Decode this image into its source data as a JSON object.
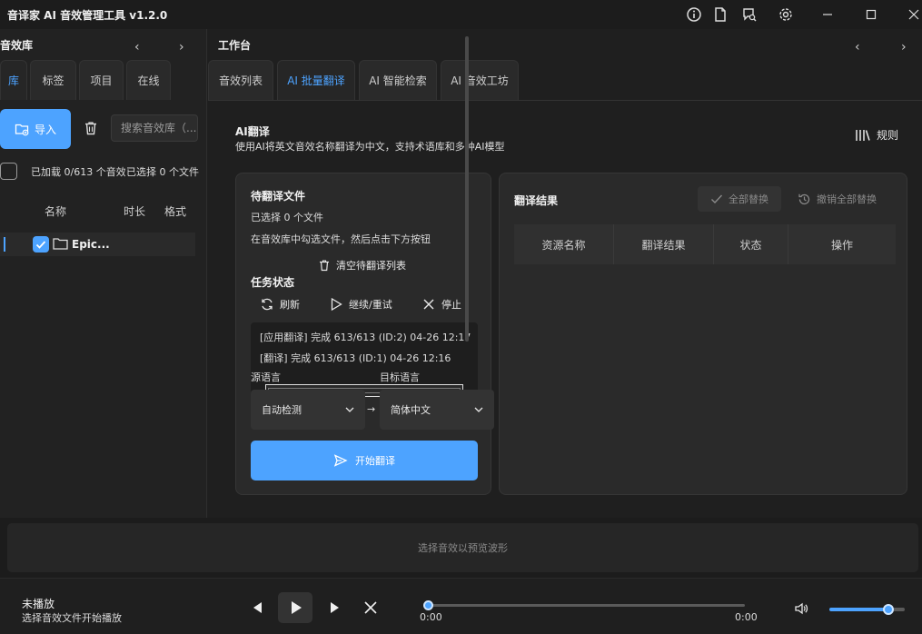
{
  "app": {
    "title": "音译家 AI 音效管理工具 v1.2.0"
  },
  "titlebar": {
    "icons": [
      "info-icon",
      "document-icon",
      "chat-search-icon",
      "gear-icon"
    ],
    "window_controls": [
      "minimize-icon",
      "maximize-icon",
      "close-icon"
    ]
  },
  "library": {
    "title": "音效库",
    "tabs": [
      {
        "label": "库",
        "active": true
      },
      {
        "label": "标签",
        "active": false
      },
      {
        "label": "项目",
        "active": false
      },
      {
        "label": "在线",
        "active": false
      }
    ],
    "import_label": "导入",
    "search_placeholder": "搜索音效库（...",
    "loaded_text": "已加载 0/613 个音效",
    "selected_text": "已选择 0 个文件",
    "columns": {
      "name": "名称",
      "duration": "时长",
      "format": "格式"
    },
    "rows": [
      {
        "name": "Epic...",
        "checked": true
      }
    ]
  },
  "workspace": {
    "title": "工作台",
    "tabs": [
      {
        "label": "音效列表",
        "active": false
      },
      {
        "label": "AI 批量翻译",
        "active": true
      },
      {
        "label": "AI 智能检索",
        "active": false
      },
      {
        "label": "AI 音效工坊",
        "active": false
      }
    ],
    "ai_title": "AI翻译",
    "ai_desc": "使用AI将英文音效名称翻译为中文，支持术语库和多种AI模型",
    "rules_label": "规则",
    "pending": {
      "title": "待翻译文件",
      "selected": "已选择 0 个文件",
      "hint": "在音效库中勾选文件，然后点击下方按钮",
      "clear_label": "清空待翻译列表"
    },
    "task": {
      "title": "任务状态",
      "refresh_label": "刷新",
      "resume_label": "继续/重试",
      "stop_label": "停止",
      "logs": [
        "[应用翻译] 完成  613/613  (ID:2)  04-26 12:17",
        "[翻译] 完成  613/613  (ID:1)  04-26 12:16"
      ]
    },
    "languages": {
      "source_label": "源语言",
      "target_label": "目标语言",
      "source_value": "自动检测",
      "arrow": "→",
      "target_value": "简体中文"
    },
    "start_label": "开始翻译",
    "results": {
      "title": "翻译结果",
      "replace_all_label": "全部替换",
      "undo_all_label": "撤销全部替换",
      "columns": [
        "资源名称",
        "翻译结果",
        "状态",
        "操作"
      ]
    }
  },
  "waveform": {
    "placeholder": "选择音效以预览波形"
  },
  "player": {
    "title": "未播放",
    "subtitle": "选择音效文件开始播放",
    "current_time": "0:00",
    "total_time": "0:00",
    "progress": 0,
    "volume": 0.85
  },
  "colors": {
    "accent": "#4da3ff",
    "background": "#202020",
    "card": "#2a2a2a"
  }
}
